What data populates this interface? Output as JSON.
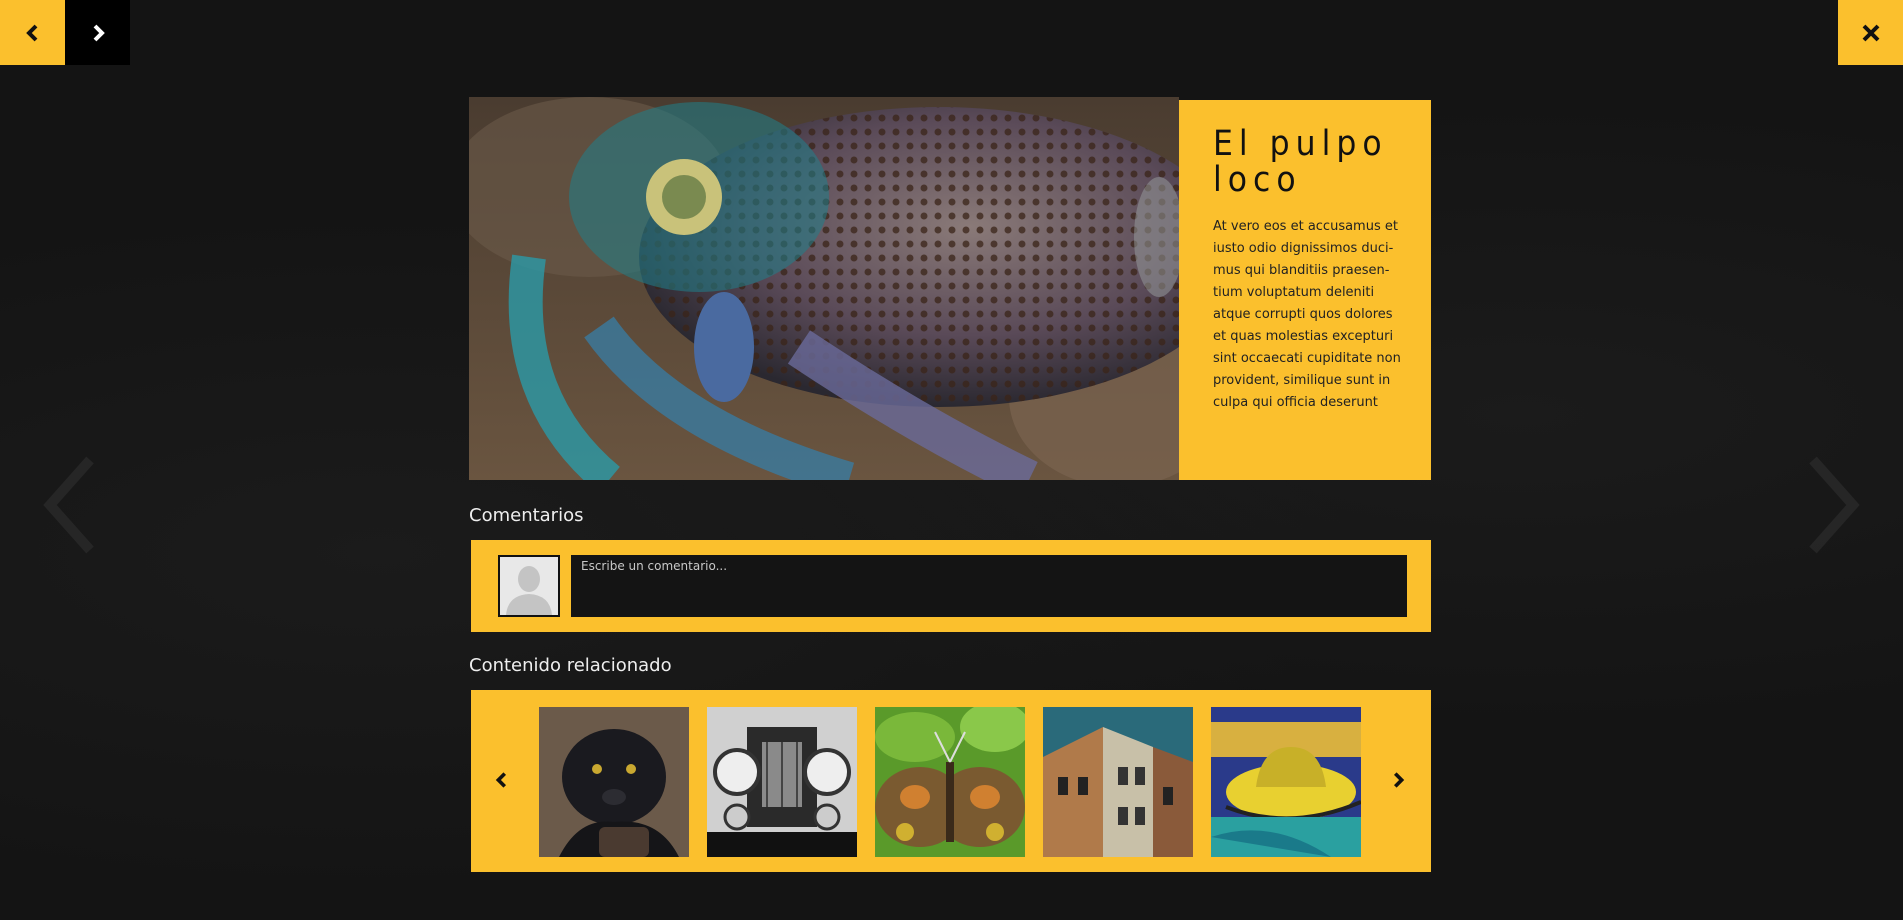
{
  "navigation": {
    "prev_icon": "chevron-left-icon",
    "next_icon": "chevron-right-icon",
    "close_icon": "close-icon"
  },
  "article": {
    "title": "El pulpo loco",
    "body": "At vero eos et accusamus et iusto odio dignissimos duci-mus qui blanditiis praesen-tium voluptatum deleniti atque corrupti quos dolores et quas molestias excepturi sint occaecati cupiditate non provident, similique sunt in culpa qui officia deserunt"
  },
  "comments": {
    "title": "Comentarios",
    "placeholder": "Escribe un comentario..."
  },
  "related": {
    "title": "Contenido relacionado",
    "items": [
      "black-panther",
      "vintage-car",
      "butterfly",
      "painted-buildings",
      "yellow-hat-painting"
    ]
  },
  "colors": {
    "accent": "#fbc02d",
    "background": "#151515"
  }
}
